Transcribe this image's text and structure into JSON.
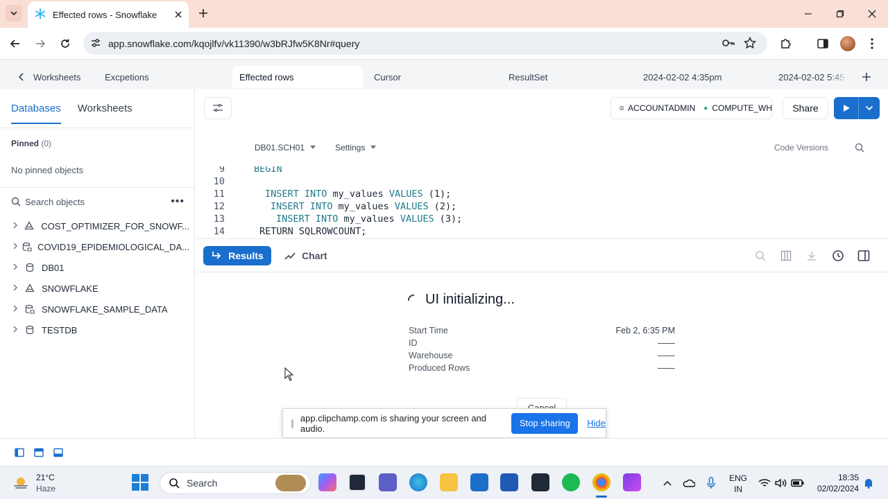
{
  "browser": {
    "tab_title": "Effected rows - Snowflake",
    "url": "app.snowflake.com/kqojlfv/vk11390/w3bRJfw5K8Nr#query"
  },
  "worksheet_tabs": {
    "back_label": "Worksheets",
    "items": [
      "Excpetions",
      "Effected rows",
      "Cursor",
      "ResultSet",
      "2024-02-02 4:35pm",
      "2024-02-02 5:45"
    ]
  },
  "sidebar": {
    "tabs": [
      "Databases",
      "Worksheets"
    ],
    "pinned_label": "Pinned",
    "pinned_count": "(0)",
    "no_pinned": "No pinned objects",
    "search_placeholder": "Search objects",
    "databases": [
      {
        "name": "COST_OPTIMIZER_FOR_SNOWF...",
        "icon": "shared-db-icon"
      },
      {
        "name": "COVID19_EPIDEMIOLOGICAL_DA...",
        "icon": "marketplace-db-icon"
      },
      {
        "name": "DB01",
        "icon": "database-icon"
      },
      {
        "name": "SNOWFLAKE",
        "icon": "shared-db-icon"
      },
      {
        "name": "SNOWFLAKE_SAMPLE_DATA",
        "icon": "marketplace-db-icon"
      },
      {
        "name": "TESTDB",
        "icon": "database-icon"
      }
    ]
  },
  "editor": {
    "role": "ACCOUNTADMIN",
    "warehouse": "COMPUTE_WH",
    "share_label": "Share",
    "context": "DB01.SCH01",
    "settings_label": "Settings",
    "code_versions_label": "Code Versions",
    "code_lines": [
      {
        "num": "9",
        "indent": 0,
        "parts": [
          {
            "t": "BEGIN",
            "k": true
          }
        ]
      },
      {
        "num": "10",
        "indent": 0,
        "parts": []
      },
      {
        "num": "11",
        "indent": 2,
        "parts": [
          {
            "t": "INSERT INTO",
            "k": true
          },
          {
            "t": " my_values ",
            "k": false
          },
          {
            "t": "VALUES",
            "k": true
          },
          {
            "t": " (1);",
            "k": false
          }
        ]
      },
      {
        "num": "12",
        "indent": 3,
        "parts": [
          {
            "t": "INSERT INTO",
            "k": true
          },
          {
            "t": " my_values ",
            "k": false
          },
          {
            "t": "VALUES",
            "k": true
          },
          {
            "t": " (2);",
            "k": false
          }
        ]
      },
      {
        "num": "13",
        "indent": 4,
        "parts": [
          {
            "t": "INSERT INTO",
            "k": true
          },
          {
            "t": " my_values ",
            "k": false
          },
          {
            "t": "VALUES",
            "k": true
          },
          {
            "t": " (3);",
            "k": false
          }
        ]
      },
      {
        "num": "14",
        "indent": 1,
        "parts": [
          {
            "t": "RETURN SQLROWCOUNT;",
            "k": false
          }
        ]
      }
    ]
  },
  "results": {
    "results_label": "Results",
    "chart_label": "Chart",
    "status": "UI initializing...",
    "details": [
      {
        "label": "Start Time",
        "value": "Feb 2, 6:35 PM"
      },
      {
        "label": "ID",
        "value": "——"
      },
      {
        "label": "Warehouse",
        "value": "——"
      },
      {
        "label": "Produced Rows",
        "value": "——"
      }
    ],
    "cancel_label": "Cancel"
  },
  "share_notice": {
    "text": "app.clipchamp.com is sharing your screen and audio.",
    "stop_label": "Stop sharing",
    "hide_label": "Hide"
  },
  "taskbar": {
    "temperature": "21°C",
    "weather": "Haze",
    "search_label": "Search",
    "lang_top": "ENG",
    "lang_bottom": "IN",
    "time": "18:35",
    "date": "02/02/2024"
  },
  "colors": {
    "accent": "#1a6ecd",
    "tabstrip": "#f9dfd6",
    "keyword": "#1e7a8c"
  }
}
